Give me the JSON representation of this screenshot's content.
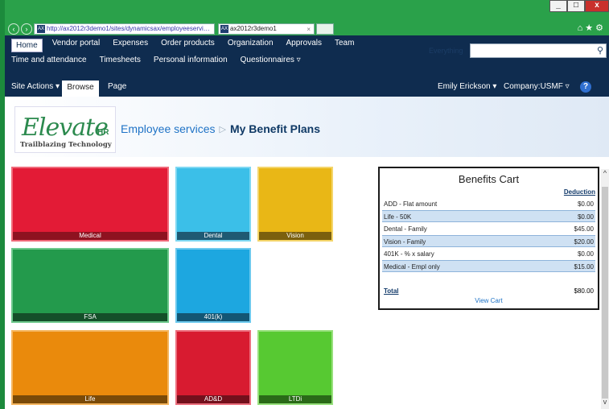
{
  "browser": {
    "url": "http://ax2012r3demo1/sites/dynamicsax/employeeservi…",
    "tab_title": "ax2012r3demo1",
    "favicon_text": "AX"
  },
  "nav": {
    "row1": [
      "Home",
      "Vendor portal",
      "Expenses",
      "Order products",
      "Organization",
      "Approvals",
      "Team"
    ],
    "row2": [
      "Time and attendance",
      "Timesheets",
      "Personal information",
      "Questionnaires ▿"
    ],
    "search_scope": "Everything",
    "search_placeholder": ""
  },
  "ribbon": {
    "site_actions": "Site Actions ▾",
    "browse": "Browse",
    "page": "Page",
    "user": "Emily Erickson ▾",
    "company": "Company:USMF ▿",
    "help": "?"
  },
  "header": {
    "logo_word": "Elevate",
    "logo_suffix": "HR",
    "logo_tagline": "Trailblazing Technology",
    "crumb_parent": "Employee services",
    "crumb_sep": "▷",
    "page_title": "My Benefit Plans"
  },
  "tiles": [
    {
      "label": "Medical",
      "bg": "#e31b36",
      "band": "#8e1220",
      "border": "#f06a7a"
    },
    {
      "label": "Dental",
      "bg": "#3bbfe8",
      "band": "#1f5a73",
      "border": "#7fd8f2"
    },
    {
      "label": "Vision",
      "bg": "#e9b716",
      "band": "#7b600e",
      "border": "#f4d56a"
    },
    {
      "label": "FSA",
      "bg": "#239a4c",
      "band": "#144f29",
      "border": "#6cc88b"
    },
    {
      "label": "401(k)",
      "bg": "#1da7e0",
      "band": "#135674",
      "border": "#6cc9ee"
    },
    {
      "label": "Life",
      "bg": "#ea8a0c",
      "band": "#7a4a08",
      "border": "#f5b660"
    },
    {
      "label": "AD&D",
      "bg": "#d81b30",
      "band": "#73101c",
      "border": "#ec6f7e"
    },
    {
      "label": "LTDi",
      "bg": "#57c932",
      "band": "#2a6a18",
      "border": "#97e07c"
    }
  ],
  "cart": {
    "title": "Benefits Cart",
    "column_header": "Deduction",
    "rows": [
      {
        "name": "ADD - Flat amount",
        "amount": "$0.00"
      },
      {
        "name": "Life - 50K",
        "amount": "$0.00"
      },
      {
        "name": "Dental - Family",
        "amount": "$45.00"
      },
      {
        "name": "Vision - Family",
        "amount": "$20.00"
      },
      {
        "name": "401K - % x salary",
        "amount": "$0.00"
      },
      {
        "name": "Medical - Empl only",
        "amount": "$15.00"
      }
    ],
    "total_label": "Total",
    "total_amount": "$80.00",
    "view_cart": "View Cart"
  }
}
